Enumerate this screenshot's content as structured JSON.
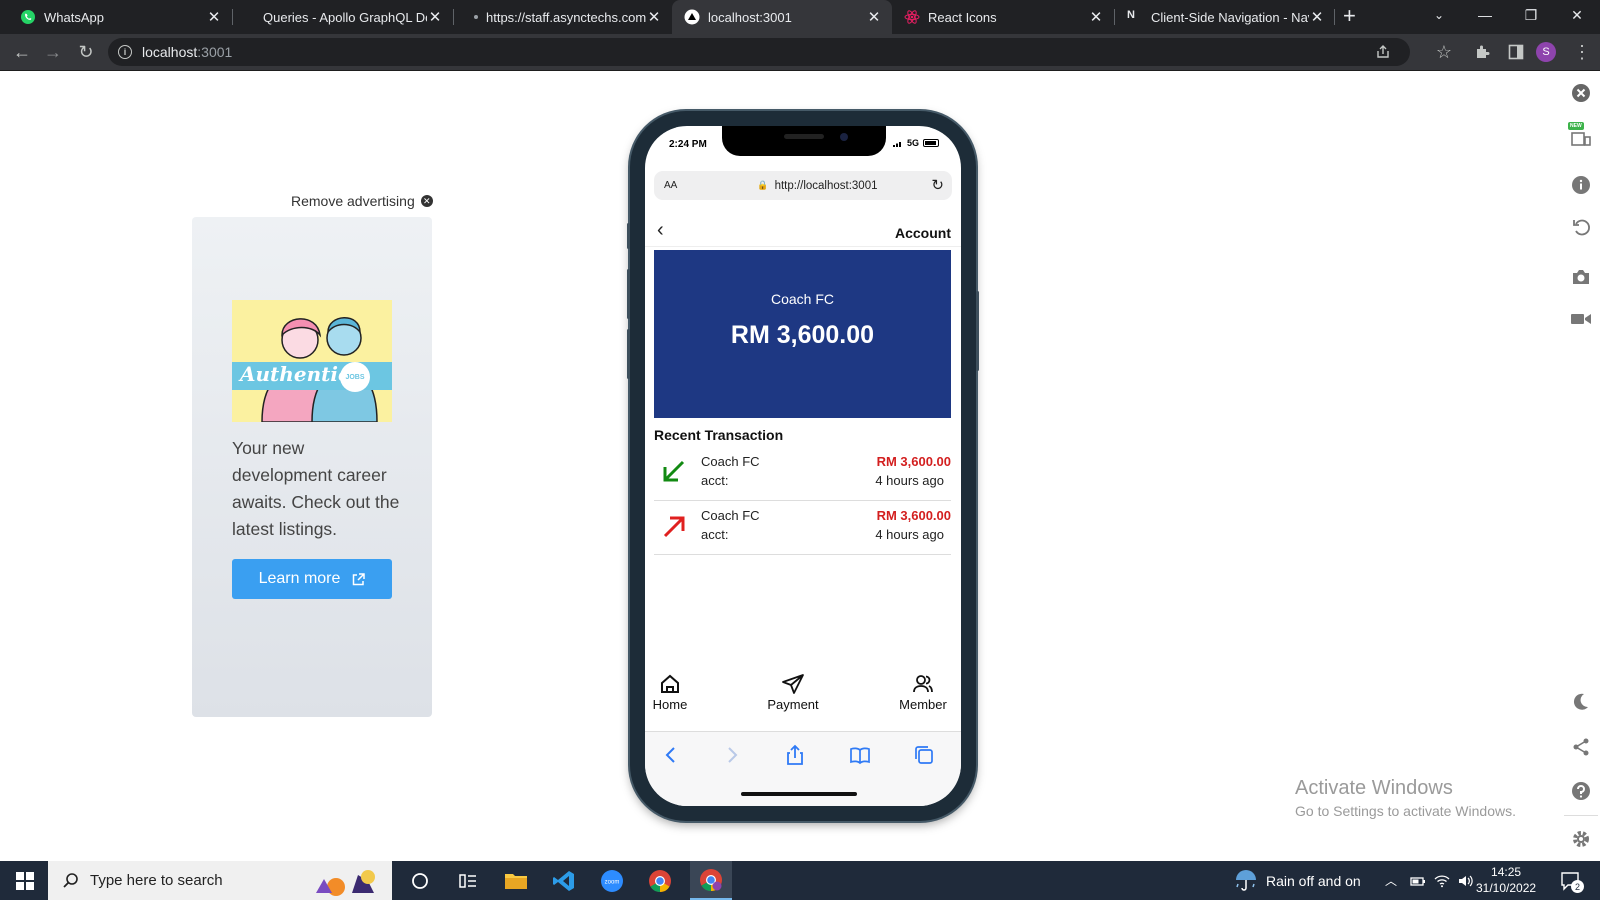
{
  "browser": {
    "tabs": [
      {
        "title": "WhatsApp",
        "active": false,
        "favicon": "whatsapp-icon"
      },
      {
        "title": "Queries - Apollo GraphQL Do",
        "active": false,
        "favicon": "apollo-icon"
      },
      {
        "title": "https://staff.asynctechs.com/(",
        "active": false,
        "favicon": "page-icon"
      },
      {
        "title": "localhost:3001",
        "active": true,
        "favicon": "triangle-icon"
      },
      {
        "title": "React Icons",
        "active": false,
        "favicon": "react-icon"
      },
      {
        "title": "Client-Side Navigation - Navi",
        "active": false,
        "favicon": "notion-icon"
      }
    ],
    "url_host": "localhost",
    "url_port": ":3001",
    "profile_initial": "S"
  },
  "ad": {
    "remove_label": "Remove advertising",
    "image_text": "Authentic",
    "image_badge": "JOBS",
    "body": "Your new development career awaits. Check out the latest listings.",
    "button_label": "Learn more"
  },
  "phone": {
    "status_time": "2:24 PM",
    "network": "5G",
    "address_aa": "AA",
    "address_url": "http://localhost:3001",
    "header_title": "Account",
    "balance_name": "Coach FC",
    "balance_amount": "RM 3,600.00",
    "recent_title": "Recent Transaction",
    "transactions": [
      {
        "name": "Coach FC",
        "acct": "acct:",
        "amount": "RM 3,600.00",
        "time": "4 hours ago",
        "direction": "in",
        "color": "#128a12"
      },
      {
        "name": "Coach FC",
        "acct": "acct:",
        "amount": "RM 3,600.00",
        "time": "4 hours ago",
        "direction": "out",
        "color": "#e0201f"
      }
    ],
    "nav": [
      {
        "label": "Home",
        "icon": "home-icon"
      },
      {
        "label": "Payment",
        "icon": "send-icon"
      },
      {
        "label": "Member",
        "icon": "users-icon"
      }
    ]
  },
  "watermark": {
    "line1": "Activate Windows",
    "line2": "Go to Settings to activate Windows."
  },
  "taskbar": {
    "search_placeholder": "Type here to search",
    "weather": "Rain off and on",
    "time": "14:25",
    "date": "31/10/2022",
    "notifications": "2"
  },
  "side_panel": {
    "new_badge": "NEW"
  }
}
